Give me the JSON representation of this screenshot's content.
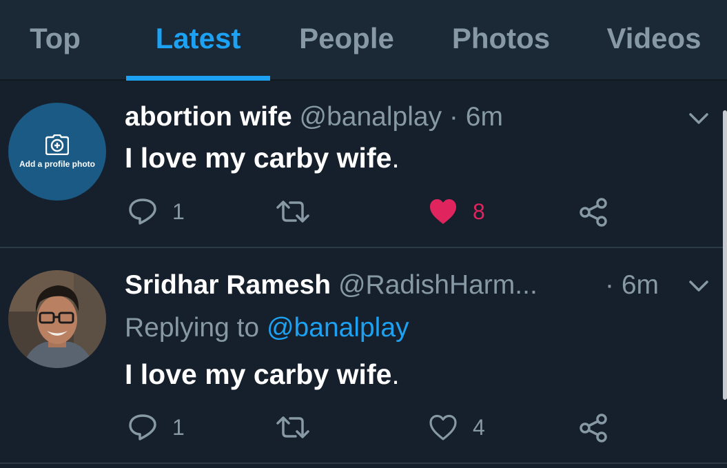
{
  "tabs": [
    {
      "label": "Top",
      "active": false
    },
    {
      "label": "Latest",
      "active": true
    },
    {
      "label": "People",
      "active": false
    },
    {
      "label": "Photos",
      "active": false
    },
    {
      "label": "Videos",
      "active": false
    }
  ],
  "colors": {
    "background": "#16202c",
    "tabbar": "#1b2836",
    "accent": "#1da1f2",
    "muted": "#8899a6",
    "like": "#e0245e",
    "avatar_placeholder": "#1a5a85"
  },
  "tweets": [
    {
      "display_name": "abortion wife",
      "handle": "@banalplay",
      "separator": "·",
      "time": "6m",
      "avatar_caption": "Add a profile photo",
      "avatar_icon": "camera-plus-icon",
      "text": "I love my carby wife",
      "text_end": ".",
      "replies": "1",
      "likes": "8",
      "liked": true
    },
    {
      "display_name": "Sridhar Ramesh",
      "handle": "@RadishHarm...",
      "separator": "·",
      "time": "6m",
      "avatar_icon": "user-photo-avatar",
      "reply_prefix": "Replying to",
      "reply_to": "@banalplay",
      "text": "I love my carby wife",
      "text_end": ".",
      "replies": "1",
      "likes": "4",
      "liked": false
    }
  ]
}
